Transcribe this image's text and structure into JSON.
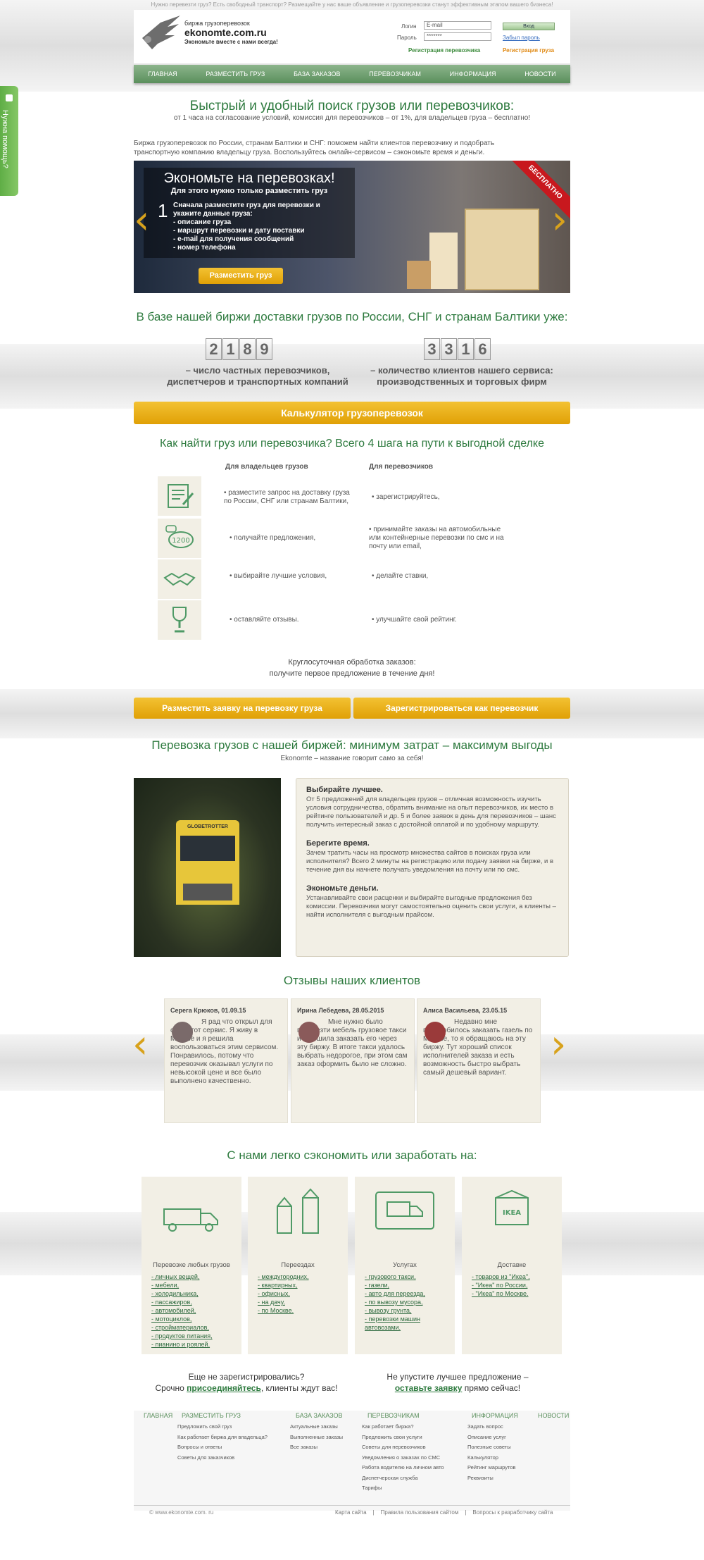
{
  "topline": "Нужно перевезти груз? Есть свободный транспорт? Размещайте у нас ваше объявление и грузоперевозки станут эффективным этапом вашего бизнеса!",
  "side_tab": "Нужна помощь?",
  "logo": {
    "line1": "биржа грузоперевозок",
    "line2": "ekonomte.com.ru",
    "line3": "Экономьте вместе с нами всегда!"
  },
  "login": {
    "login_label": "Логин",
    "password_label": "Пароль",
    "email_value": "E-mail",
    "password_value": "*******",
    "submit": "Вход",
    "forgot": "Забыл пароль",
    "reg_carrier": "Регистрация перевозчика",
    "reg_cargo": "Регистрация груза"
  },
  "nav": [
    "ГЛАВНАЯ",
    "РАЗМЕСТИТЬ ГРУЗ",
    "БАЗА ЗАКАЗОВ",
    "ПЕРЕВОЗЧИКАМ",
    "ИНФОРМАЦИЯ",
    "НОВОСТИ"
  ],
  "hero": {
    "title": "Быстрый и удобный поиск грузов или перевозчиков:",
    "subtitle": "от 1 часа на согласование условий, комиссия для перевозчиков – от 1%, для владельцев груза – бесплатно!",
    "intro": "Биржа грузоперевозок по России, странам Балтики и СНГ: поможем найти клиентов перевозчику и подобрать транспортную компанию владельцу груза. Воспользуйтесь онлайн-сервисом – сэкономьте время и деньги."
  },
  "banner": {
    "title": "Экономьте на перевозках!",
    "subtitle": "Для этого нужно только разместить груз",
    "step_number": "1",
    "step_text": "Сначала разместите груз для перевозки и укажите данные груза:",
    "items": [
      "- описание груза",
      "- маршрут перевозки и дату поставки",
      "- e-mail для получения сообщений",
      "- номер телефона"
    ],
    "button": "Разместить груз",
    "ribbon": "БЕСПЛАТНО"
  },
  "stats": {
    "title": "В базе нашей биржи доставки грузов по России, СНГ и странам Балтики уже:",
    "carriers_digits": [
      "2",
      "1",
      "8",
      "9"
    ],
    "carriers_caption": "– число частных перевозчиков, диспетчеров и транспортных компаний",
    "clients_digits": [
      "3",
      "3",
      "1",
      "6"
    ],
    "clients_caption": "– количество клиентов нашего сервиса: производственных и торговых фирм"
  },
  "calc_button": "Калькулятор грузоперевозок",
  "steps": {
    "title": "Как найти груз или перевозчика? Всего 4 шага на пути к выгодной сделке",
    "col_owners": "Для владельцев грузов",
    "col_carriers": "Для перевозчиков",
    "badge": "1200",
    "rows": [
      {
        "icon": "form-icon",
        "owner": "• разместите запрос на доставку груза по России, СНГ или странам Балтики,",
        "carrier": "• зарегистрируйтесь,"
      },
      {
        "icon": "chat-icon",
        "owner": "• получайте предложения,",
        "carrier": "• принимайте заказы на автомобильные или контейнерные перевозки по смс и на почту или email,"
      },
      {
        "icon": "handshake-icon",
        "owner": "• выбирайте лучшие условия,",
        "carrier": "• делайте ставки,"
      },
      {
        "icon": "trophy-icon",
        "owner": "• оставляйте отзывы.",
        "carrier": "• улучшайте свой рейтинг."
      }
    ],
    "note1": "Круглосуточная обработка заказов:",
    "note2": "получите первое предложение в течение дня!"
  },
  "cta": {
    "left": "Разместить заявку на перевозку груза",
    "right": "Зарегистрироваться как перевозчик"
  },
  "benefits": {
    "title": "Перевозка грузов с нашей биржей: минимум затрат – максимум выгоды",
    "subtitle": "Ekonomte – название говорит само за себя!",
    "truck_text": "GLOBETROTTER",
    "items": [
      {
        "h": "Выбирайте лучшее.",
        "p": "От 5 предложений для владельцев грузов – отличная возможность изучить условия сотрудничества, обратить внимание на опыт перевозчиков, их место в рейтинге пользователей и др. 5 и более заявок в день для перевозчиков – шанс получить интересный заказ с достойной оплатой и по удобному маршруту."
      },
      {
        "h": "Берегите время.",
        "p": "Зачем тратить часы на просмотр множества сайтов в поисках груза или исполнителя? Всего 2 минуты на регистрацию или подачу заявки на бирже, и в течение дня вы начнете получать уведомления на почту или по смс."
      },
      {
        "h": "Экономьте деньги.",
        "p": "Устанавливайте свои расценки и выбирайте выгодные предложения без комиссии. Перевозчики могут самостоятельно оценить свои услуги, а клиенты – найти исполнителя с выгодным прайсом."
      }
    ]
  },
  "reviews": {
    "title": "Отзывы наших клиентов",
    "items": [
      {
        "name": "Серега Крюков, 01.09.15",
        "text": "Я рад что открыл для себя этот сервис. Я живу в Москве и я решила воспользоваться этим сервисом. Понравилось, потому что перевозчик оказывал услуги по невысокой цене и все было выполнено качественно."
      },
      {
        "name": "Ирина Лебедева, 28.05.2015",
        "text": "Мне нужно было перевезти мебель грузовое такси и я решила заказать его через эту биржу. В итоге такси удалось выбрать недорогое, при этом сам заказ оформить было не сложно."
      },
      {
        "name": "Алиса Васильева, 23.05.15",
        "text": "Недавно мне понадобилось заказать газель по Москве, то я обращаюсь на эту биржу. Тут хороший список исполнителей заказа и есть возможность быстро выбрать самый дешевый вариант."
      }
    ]
  },
  "services": {
    "title": "С нами легко сэкономить или заработать на:",
    "cards": [
      {
        "icon": "truck-icon",
        "title": "Перевозке любых грузов",
        "links": [
          "- личных вещей,",
          "- мебели,",
          "- холодильника,",
          "- пассажиров,",
          "- автомобилей,",
          "- мотоциклов,",
          "- стройматериалов,",
          "- продуктов питания,",
          "- пианино и роялей."
        ]
      },
      {
        "icon": "buildings-icon",
        "title": "Переездах",
        "links": [
          "- междугородних,",
          "- квартирных,",
          "- офисных,",
          "- на дачу,",
          "- по Москве."
        ]
      },
      {
        "icon": "van-icon",
        "title": "Услугах",
        "links": [
          "- грузового такси,",
          "- газели,",
          "- авто для переезда,",
          "- по вывозу мусора,",
          "- вывозу грунта,",
          "- перевозки машин автовозами."
        ]
      },
      {
        "icon": "box-icon",
        "title": "Доставке",
        "box_label": "IKEA",
        "links": [
          "- товаров из \"Икеа\",",
          "- \"Икеа\" по России,",
          "- \"Икеа\" по Москве."
        ]
      }
    ]
  },
  "join": {
    "l1": "Еще не зарегистрировались?",
    "l2a": "Срочно ",
    "l2link": "присоединяйтесь",
    "l2b": ", клиенты ждут вас!",
    "r1": "Не упустите лучшее предложение –",
    "r2link": "оставьте заявку",
    "r2b": " прямо сейчас!"
  },
  "footer": {
    "heads": [
      "ГЛАВНАЯ",
      "РАЗМЕСТИТЬ ГРУЗ",
      "БАЗА ЗАКАЗОВ",
      "ПЕРЕВОЗЧИКАМ",
      "ИНФОРМАЦИЯ",
      "НОВОСТИ"
    ],
    "col1": [
      "Предложить свой груз",
      "Как работает биржа для владельца?",
      "Вопросы и ответы",
      "Советы для заказчиков"
    ],
    "col2": [
      "Актуальные заказы",
      "Выполненные заказы",
      "Все заказы"
    ],
    "col3": [
      "Как работает биржа?",
      "Предложить свои услуги",
      "Советы для перевозчиков",
      "Уведомления о заказах по СМС",
      "Работа водителю на личном авто",
      "Диспетчерская служба",
      "Тарифы"
    ],
    "col4": [
      "Задать вопрос",
      "Описание услуг",
      "Полезные советы",
      "Калькулятор",
      "Рейтинг маршрутов",
      "Реквизиты"
    ],
    "copyright": "© www.ekonomte.com. ru",
    "links": [
      "Карта сайта",
      "|",
      "Правила пользования сайтом",
      "|",
      "Вопросы к разработчику сайта"
    ]
  }
}
